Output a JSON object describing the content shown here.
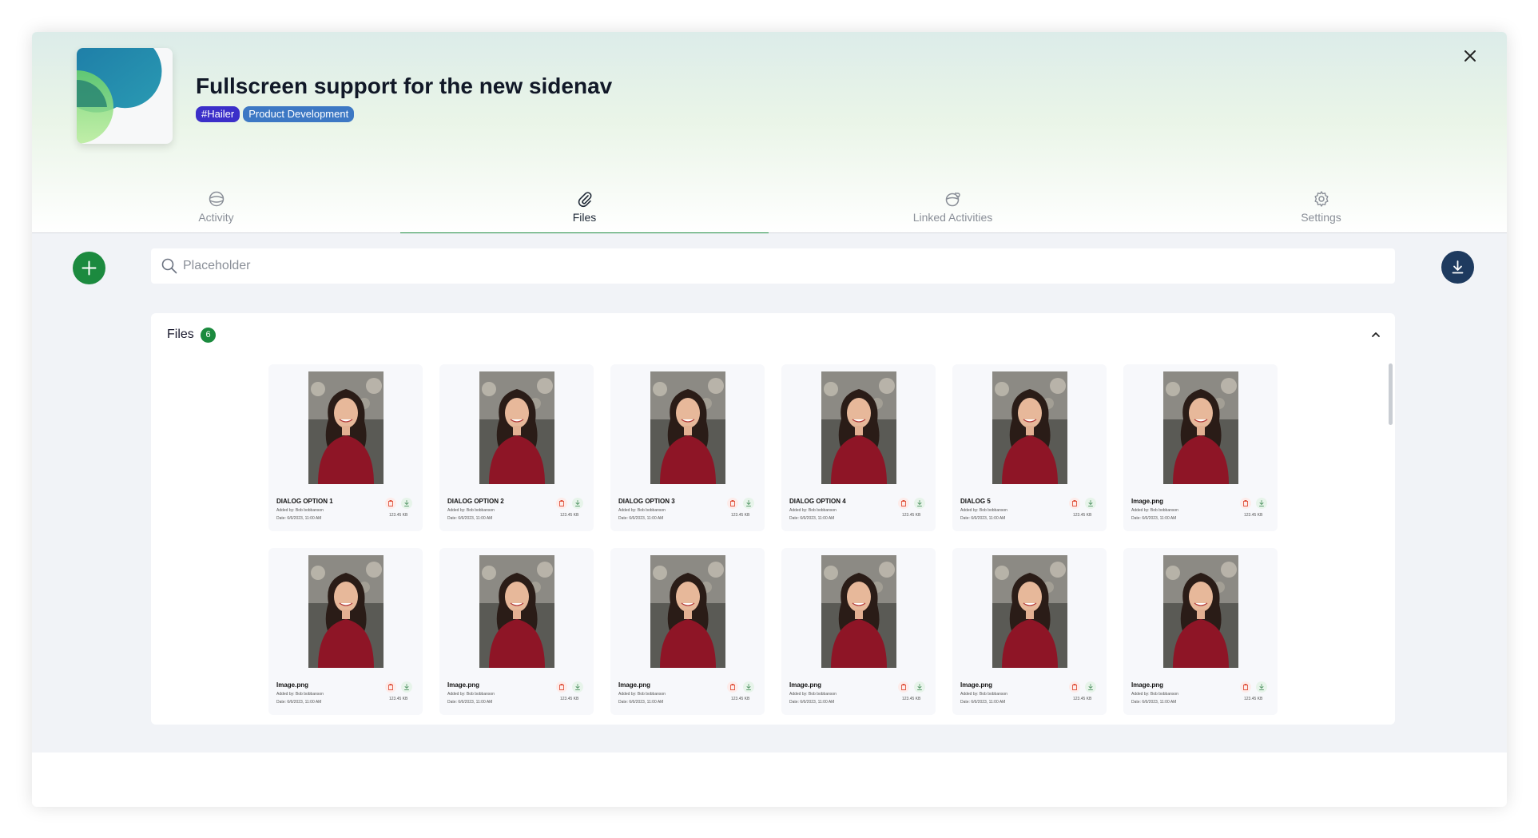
{
  "header": {
    "title": "Fullscreen support for the new sidenav",
    "tags": [
      {
        "label": "#Hailer",
        "color": "#3b2fc9"
      },
      {
        "label": "Product Development",
        "color": "#3d78c4"
      }
    ],
    "close_icon": "close-icon"
  },
  "tabs": [
    {
      "label": "Activity",
      "icon": "activity-icon",
      "active": false
    },
    {
      "label": "Files",
      "icon": "paperclip-icon",
      "active": true
    },
    {
      "label": "Linked Activities",
      "icon": "linked-activities-icon",
      "active": false
    },
    {
      "label": "Settings",
      "icon": "gear-icon",
      "active": false
    }
  ],
  "toolbar": {
    "add_icon": "plus-icon",
    "search_placeholder": "Placeholder",
    "download_all_icon": "download-icon"
  },
  "files": {
    "title": "Files",
    "count": "6",
    "items": [
      {
        "name": "DIALOG OPTION 1",
        "added_by": "Added by: Bob bobbanson",
        "date": "Date: 6/6/2023, 11:00 AM",
        "size": "123.45 KB"
      },
      {
        "name": "DIALOG OPTION 2",
        "added_by": "Added by: Bob bobbanson",
        "date": "Date: 6/6/2023, 11:00 AM",
        "size": "123.45 KB"
      },
      {
        "name": "DIALOG OPTION 3",
        "added_by": "Added by: Bob bobbanson",
        "date": "Date: 6/6/2023, 11:00 AM",
        "size": "123.45 KB"
      },
      {
        "name": "DIALOG OPTION 4",
        "added_by": "Added by: Bob bobbanson",
        "date": "Date: 6/6/2023, 11:00 AM",
        "size": "123.45 KB"
      },
      {
        "name": "DIALOG 5",
        "added_by": "Added by: Bob bobbanson",
        "date": "Date: 6/6/2023, 11:00 AM",
        "size": "123.45 KB"
      },
      {
        "name": "Image.png",
        "added_by": "Added by: Bob bobbanson",
        "date": "Date: 6/6/2023, 11:00 AM",
        "size": "123.45 KB"
      },
      {
        "name": "Image.png",
        "added_by": "Added by: Bob bobbanson",
        "date": "Date: 6/6/2023, 11:00 AM",
        "size": "123.45 KB"
      },
      {
        "name": "Image.png",
        "added_by": "Added by: Bob bobbanson",
        "date": "Date: 6/6/2023, 11:00 AM",
        "size": "123.45 KB"
      },
      {
        "name": "Image.png",
        "added_by": "Added by: Bob bobbanson",
        "date": "Date: 6/6/2023, 11:00 AM",
        "size": "123.45 KB"
      },
      {
        "name": "Image.png",
        "added_by": "Added by: Bob bobbanson",
        "date": "Date: 6/6/2023, 11:00 AM",
        "size": "123.45 KB"
      },
      {
        "name": "Image.png",
        "added_by": "Added by: Bob bobbanson",
        "date": "Date: 6/6/2023, 11:00 AM",
        "size": "123.45 KB"
      },
      {
        "name": "Image.png",
        "added_by": "Added by: Bob bobbanson",
        "date": "Date: 6/6/2023, 11:00 AM",
        "size": "123.45 KB"
      }
    ]
  },
  "colors": {
    "accent_green": "#1b8a3e",
    "download_button": "#1e3a5f",
    "delete_icon": "#e0533d"
  }
}
